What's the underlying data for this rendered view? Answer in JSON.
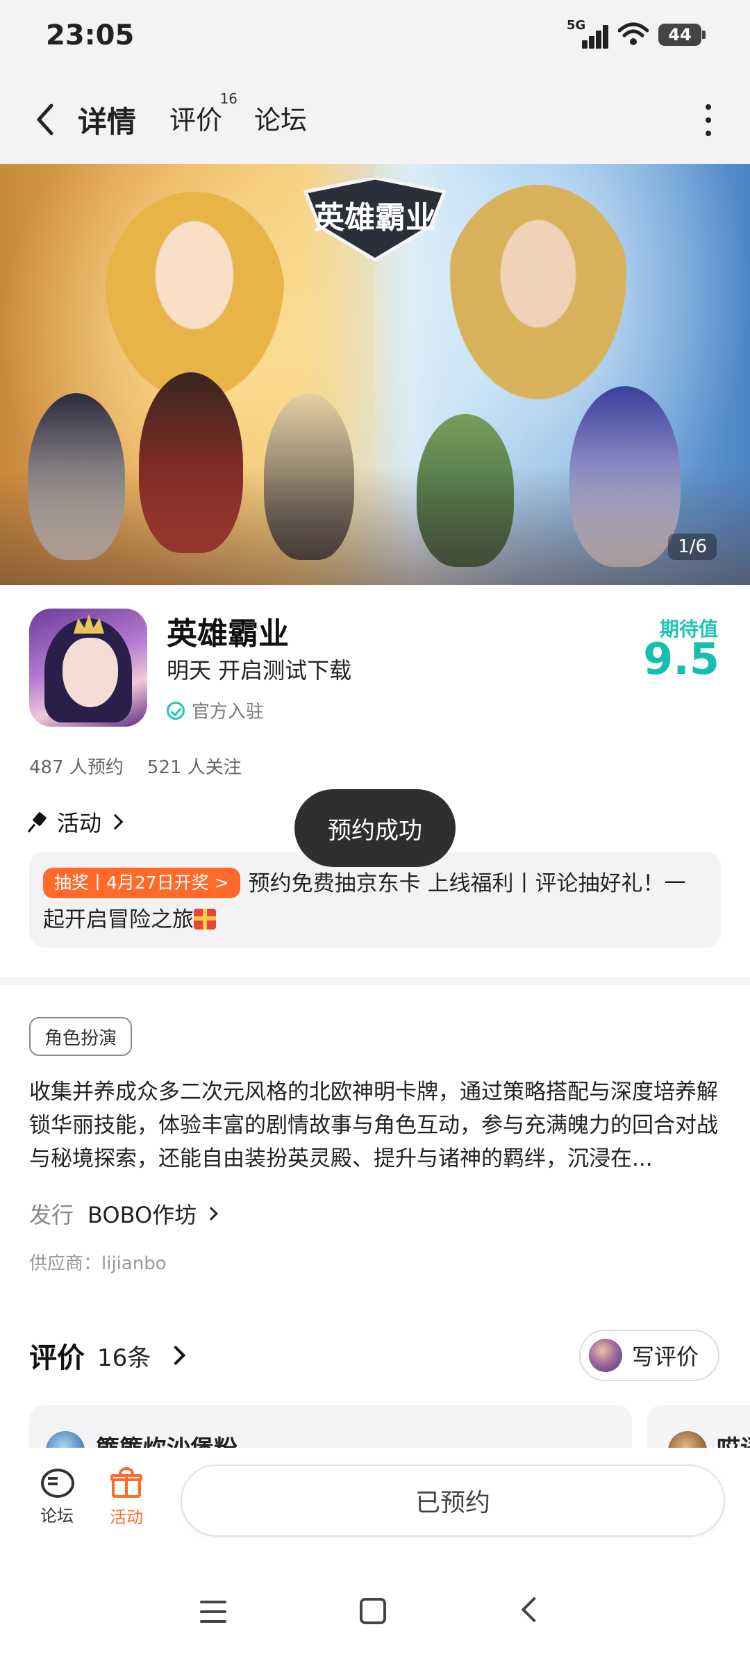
{
  "status_bar": {
    "time": "23:05",
    "network": "5G",
    "battery": "44"
  },
  "nav": {
    "tabs": [
      {
        "label": "详情",
        "active": true
      },
      {
        "label": "评价",
        "badge": "16"
      },
      {
        "label": "论坛"
      }
    ]
  },
  "banner": {
    "counter": "1/6",
    "logo_text": "英雄霸业"
  },
  "app": {
    "name": "英雄霸业",
    "subtitle": "明天 开启测试下载",
    "official": "官方入驻",
    "score_label": "期待值",
    "score": "9.5",
    "reservations": "487 人预约",
    "followers": "521 人关注"
  },
  "activity": {
    "heading": "活动",
    "tag": "抽奖丨4月27日开奖 >",
    "text": "预约免费抽京东卡 上线福利丨评论抽好礼！一起开启冒险之旅"
  },
  "toast": "预约成功",
  "details": {
    "genre": "角色扮演",
    "description": "收集并养成众多二次元风格的北欧神明卡牌，通过策略搭配与深度培养解锁华丽技能，体验丰富的剧情故事与角色互动，参与充满魄力的回合对战与秘境探索，还能自由装扮英灵殿、提升与诸神的羁绊，沉浸在...",
    "publisher_label": "发行",
    "publisher": "BOBO作坊",
    "supplier": "供应商：lijianbo"
  },
  "reviews": {
    "title": "评价",
    "count": "16条",
    "write_label": "写评价",
    "cards": [
      {
        "user": "篚篚炊沙堡粉"
      },
      {
        "user": "哎语"
      }
    ]
  },
  "bottom_bar": {
    "forum_label": "论坛",
    "activity_label": "活动",
    "reserved_label": "已预约"
  },
  "colors": {
    "accent": "#1ec5b5",
    "orange": "#ff6a2a"
  }
}
